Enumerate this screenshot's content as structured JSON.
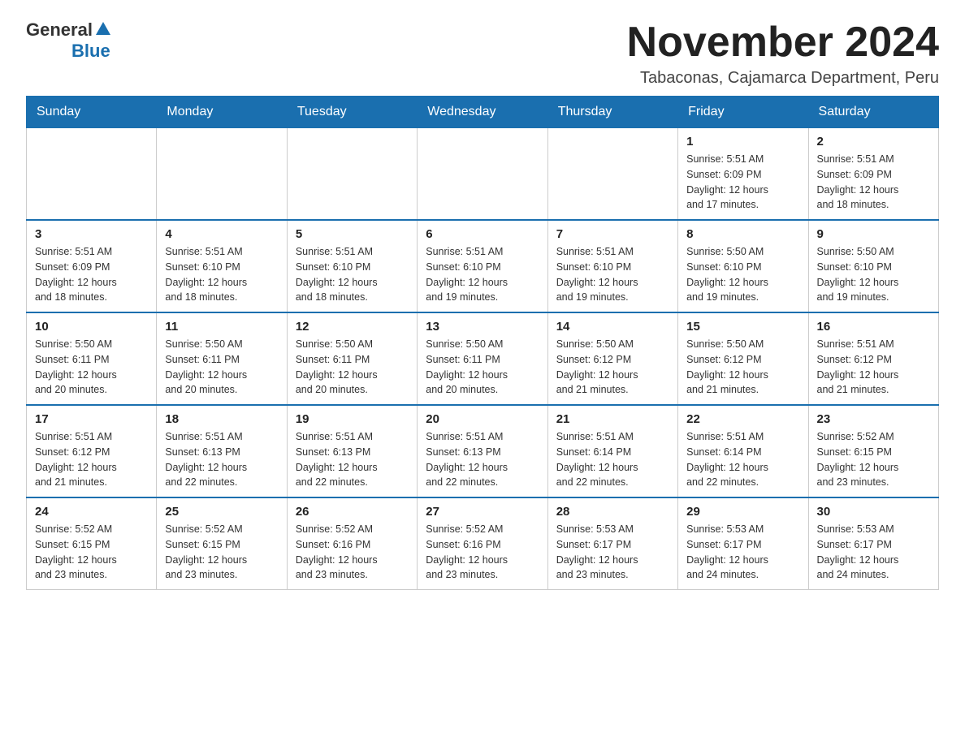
{
  "logo": {
    "general": "General",
    "blue": "Blue"
  },
  "header": {
    "month": "November 2024",
    "location": "Tabaconas, Cajamarca Department, Peru"
  },
  "weekdays": [
    "Sunday",
    "Monday",
    "Tuesday",
    "Wednesday",
    "Thursday",
    "Friday",
    "Saturday"
  ],
  "weeks": [
    [
      {
        "day": "",
        "info": ""
      },
      {
        "day": "",
        "info": ""
      },
      {
        "day": "",
        "info": ""
      },
      {
        "day": "",
        "info": ""
      },
      {
        "day": "",
        "info": ""
      },
      {
        "day": "1",
        "info": "Sunrise: 5:51 AM\nSunset: 6:09 PM\nDaylight: 12 hours\nand 17 minutes."
      },
      {
        "day": "2",
        "info": "Sunrise: 5:51 AM\nSunset: 6:09 PM\nDaylight: 12 hours\nand 18 minutes."
      }
    ],
    [
      {
        "day": "3",
        "info": "Sunrise: 5:51 AM\nSunset: 6:09 PM\nDaylight: 12 hours\nand 18 minutes."
      },
      {
        "day": "4",
        "info": "Sunrise: 5:51 AM\nSunset: 6:10 PM\nDaylight: 12 hours\nand 18 minutes."
      },
      {
        "day": "5",
        "info": "Sunrise: 5:51 AM\nSunset: 6:10 PM\nDaylight: 12 hours\nand 18 minutes."
      },
      {
        "day": "6",
        "info": "Sunrise: 5:51 AM\nSunset: 6:10 PM\nDaylight: 12 hours\nand 19 minutes."
      },
      {
        "day": "7",
        "info": "Sunrise: 5:51 AM\nSunset: 6:10 PM\nDaylight: 12 hours\nand 19 minutes."
      },
      {
        "day": "8",
        "info": "Sunrise: 5:50 AM\nSunset: 6:10 PM\nDaylight: 12 hours\nand 19 minutes."
      },
      {
        "day": "9",
        "info": "Sunrise: 5:50 AM\nSunset: 6:10 PM\nDaylight: 12 hours\nand 19 minutes."
      }
    ],
    [
      {
        "day": "10",
        "info": "Sunrise: 5:50 AM\nSunset: 6:11 PM\nDaylight: 12 hours\nand 20 minutes."
      },
      {
        "day": "11",
        "info": "Sunrise: 5:50 AM\nSunset: 6:11 PM\nDaylight: 12 hours\nand 20 minutes."
      },
      {
        "day": "12",
        "info": "Sunrise: 5:50 AM\nSunset: 6:11 PM\nDaylight: 12 hours\nand 20 minutes."
      },
      {
        "day": "13",
        "info": "Sunrise: 5:50 AM\nSunset: 6:11 PM\nDaylight: 12 hours\nand 20 minutes."
      },
      {
        "day": "14",
        "info": "Sunrise: 5:50 AM\nSunset: 6:12 PM\nDaylight: 12 hours\nand 21 minutes."
      },
      {
        "day": "15",
        "info": "Sunrise: 5:50 AM\nSunset: 6:12 PM\nDaylight: 12 hours\nand 21 minutes."
      },
      {
        "day": "16",
        "info": "Sunrise: 5:51 AM\nSunset: 6:12 PM\nDaylight: 12 hours\nand 21 minutes."
      }
    ],
    [
      {
        "day": "17",
        "info": "Sunrise: 5:51 AM\nSunset: 6:12 PM\nDaylight: 12 hours\nand 21 minutes."
      },
      {
        "day": "18",
        "info": "Sunrise: 5:51 AM\nSunset: 6:13 PM\nDaylight: 12 hours\nand 22 minutes."
      },
      {
        "day": "19",
        "info": "Sunrise: 5:51 AM\nSunset: 6:13 PM\nDaylight: 12 hours\nand 22 minutes."
      },
      {
        "day": "20",
        "info": "Sunrise: 5:51 AM\nSunset: 6:13 PM\nDaylight: 12 hours\nand 22 minutes."
      },
      {
        "day": "21",
        "info": "Sunrise: 5:51 AM\nSunset: 6:14 PM\nDaylight: 12 hours\nand 22 minutes."
      },
      {
        "day": "22",
        "info": "Sunrise: 5:51 AM\nSunset: 6:14 PM\nDaylight: 12 hours\nand 22 minutes."
      },
      {
        "day": "23",
        "info": "Sunrise: 5:52 AM\nSunset: 6:15 PM\nDaylight: 12 hours\nand 23 minutes."
      }
    ],
    [
      {
        "day": "24",
        "info": "Sunrise: 5:52 AM\nSunset: 6:15 PM\nDaylight: 12 hours\nand 23 minutes."
      },
      {
        "day": "25",
        "info": "Sunrise: 5:52 AM\nSunset: 6:15 PM\nDaylight: 12 hours\nand 23 minutes."
      },
      {
        "day": "26",
        "info": "Sunrise: 5:52 AM\nSunset: 6:16 PM\nDaylight: 12 hours\nand 23 minutes."
      },
      {
        "day": "27",
        "info": "Sunrise: 5:52 AM\nSunset: 6:16 PM\nDaylight: 12 hours\nand 23 minutes."
      },
      {
        "day": "28",
        "info": "Sunrise: 5:53 AM\nSunset: 6:17 PM\nDaylight: 12 hours\nand 23 minutes."
      },
      {
        "day": "29",
        "info": "Sunrise: 5:53 AM\nSunset: 6:17 PM\nDaylight: 12 hours\nand 24 minutes."
      },
      {
        "day": "30",
        "info": "Sunrise: 5:53 AM\nSunset: 6:17 PM\nDaylight: 12 hours\nand 24 minutes."
      }
    ]
  ]
}
